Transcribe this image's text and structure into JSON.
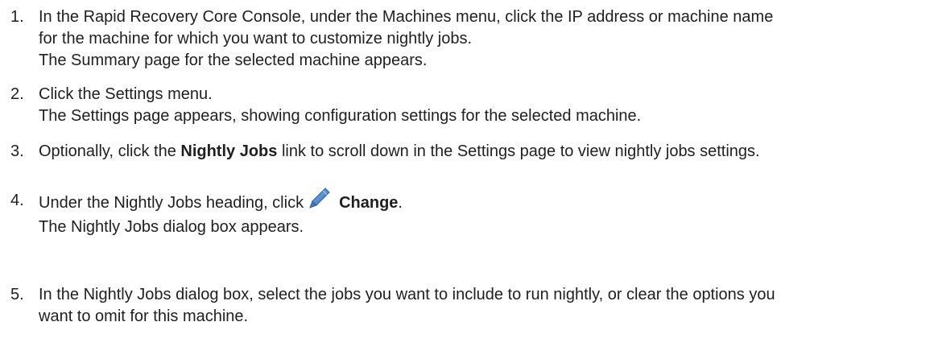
{
  "steps": [
    {
      "number": "1.",
      "lines": [
        "In the Rapid Recovery Core Console, under the Machines menu, click the IP address or machine name",
        "for the machine for which you want to customize nightly jobs.",
        "The Summary page for the selected machine appears."
      ]
    },
    {
      "number": "2.",
      "lines": [
        "Click the Settings menu.",
        "The Settings page appears, showing configuration settings for the selected machine."
      ]
    },
    {
      "number": "3.",
      "pre": "Optionally, click the ",
      "bold": "Nightly Jobs",
      "post": " link to scroll down in the Settings page to view nightly jobs settings."
    },
    {
      "number": "4.",
      "pre": "Under the Nightly Jobs heading, click",
      "icon": "pencil-icon",
      "bold": "Change",
      "post": ".",
      "result": "The Nightly Jobs dialog box appears."
    },
    {
      "number": "5.",
      "lines": [
        "In the Nightly Jobs dialog box, select the jobs you want to include to run nightly, or clear the options you",
        "want to omit for this machine."
      ]
    }
  ]
}
